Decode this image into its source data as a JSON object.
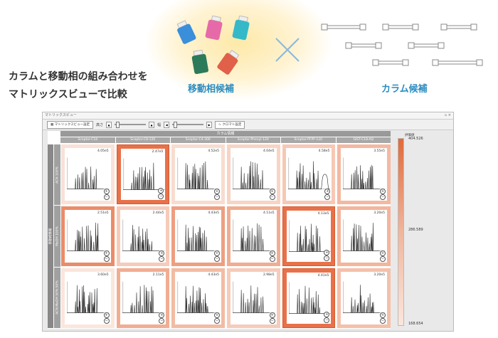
{
  "hero": {
    "headline_line1": "カラムと移動相の組み合わせを",
    "headline_line2": "マトリックスビューで比較",
    "mobile_phase_caption": "移動相候補",
    "column_caption": "カラム候補",
    "bottle_colors": [
      "#3b8ed9",
      "#e66aa8",
      "#35b9c9",
      "#2d7a5a",
      "#e0604a"
    ]
  },
  "window": {
    "title": "マトリックスビュー",
    "toolbar": {
      "matrix_settings_label": "マトリックスビュー設定",
      "height_label": "高さ",
      "width_label": "幅",
      "chromatogram_settings_label": "クロマト設定"
    },
    "column_group_header": "カラム情報",
    "columns": [
      "Sceptor-C18",
      "Sceptor-C8-120",
      "Sceptor-C4-300",
      "Sceptor-Phenyl-120",
      "Sceptor-PFPP-120",
      "GIST-C18-AQ"
    ],
    "row_group_header": "移動相情報",
    "rows": [
      "ACN 100%",
      "MeOH 100%",
      "ACN:MeOH 50%:50%"
    ],
    "cells": [
      [
        {
          "value": "4.05e5",
          "shade": "#f9e1d7"
        },
        {
          "value": "2.47e5",
          "shade": "#e8714a",
          "selected": true
        },
        {
          "value": "4.52e5",
          "shade": "#f8dccf"
        },
        {
          "value": "4.04e5",
          "shade": "#f8d4c4"
        },
        {
          "value": "4.58e5",
          "shade": "#f6c8b5",
          "trace": "bump"
        },
        {
          "value": "3.55e5",
          "shade": "#f4b8a1"
        }
      ],
      [
        {
          "value": "2.51e5",
          "shade": "#eb8c68"
        },
        {
          "value": "2.44e5",
          "shade": "#f6cbb9"
        },
        {
          "value": "4.43e5",
          "shade": "#ee9f81"
        },
        {
          "value": "4.11e5",
          "shade": "#f1ad92"
        },
        {
          "value": "4.13e5",
          "shade": "#e8714a",
          "selected": true
        },
        {
          "value": "3.20e5",
          "shade": "#f3b59c"
        }
      ],
      [
        {
          "value": "3.60e5",
          "shade": "#fbe6dc"
        },
        {
          "value": "2.11e5",
          "shade": "#f1ad92"
        },
        {
          "value": "4.43e5",
          "shade": "#f3bba3"
        },
        {
          "value": "2.98e5",
          "shade": "#f6cbb9"
        },
        {
          "value": "4.41e5",
          "shade": "#e8714a",
          "selected": true
        },
        {
          "value": "3.20e5",
          "shade": "#f4c0aa"
        }
      ]
    ],
    "legend": {
      "title": "評価値",
      "max": "404.526",
      "mid": "286.589",
      "min": "168.654"
    }
  }
}
